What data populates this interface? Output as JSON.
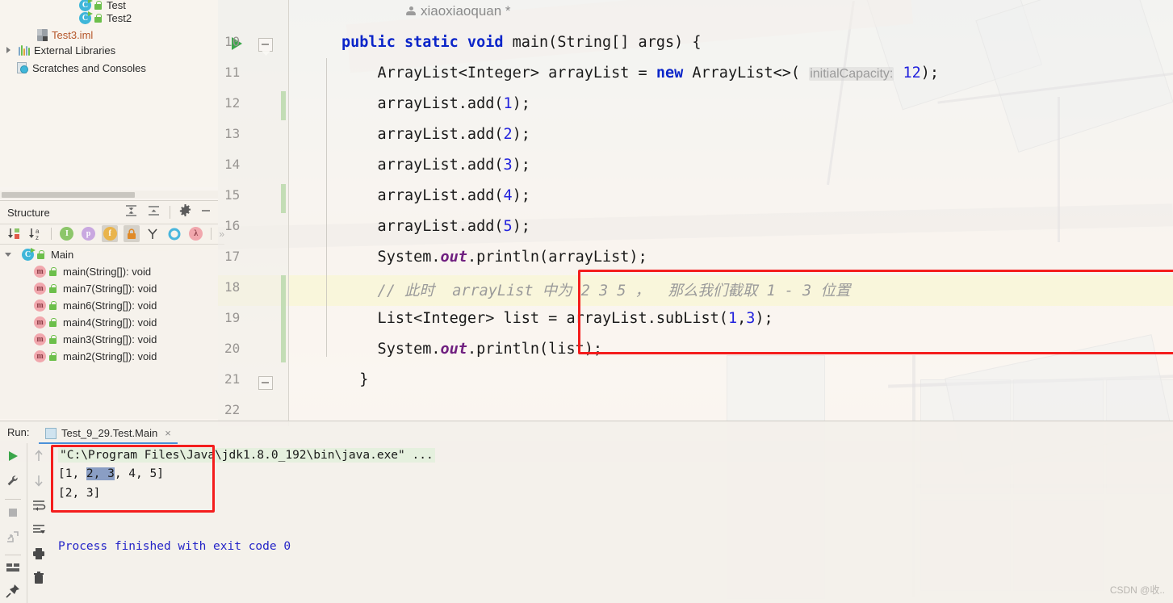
{
  "project": {
    "items": [
      {
        "label": "Test",
        "icon": "java-class-icon"
      },
      {
        "label": "Test2",
        "icon": "java-class-icon"
      },
      {
        "label": "Test3.iml",
        "icon": "iml-file-icon"
      },
      {
        "label": "External Libraries",
        "icon": "library-icon"
      },
      {
        "label": "Scratches and Consoles",
        "icon": "scratches-icon"
      }
    ]
  },
  "structure": {
    "title": "Structure",
    "header_buttons": [
      {
        "name": "expand-all-icon"
      },
      {
        "name": "collapse-all-icon"
      },
      {
        "name": "gear-icon"
      },
      {
        "name": "minimize-icon"
      }
    ],
    "toolbar_buttons": [
      {
        "name": "sort-by-visibility-icon",
        "label": ""
      },
      {
        "name": "sort-alphabetically-icon",
        "label": ""
      },
      {
        "name": "show-inherited-icon",
        "label": "I"
      },
      {
        "name": "show-properties-icon",
        "label": "p"
      },
      {
        "name": "show-fields-icon",
        "label": "f"
      },
      {
        "name": "show-non-public-icon",
        "label": ""
      },
      {
        "name": "group-by-icon",
        "label": ""
      },
      {
        "name": "show-anonymous-icon",
        "label": ""
      },
      {
        "name": "show-lambdas-icon",
        "label": "λ"
      },
      {
        "name": "more-options-icon",
        "label": "»"
      }
    ],
    "root": "Main",
    "members": [
      "main(String[]): void",
      "main7(String[]): void",
      "main6(String[]): void",
      "main4(String[]): void",
      "main3(String[]): void",
      "main2(String[]): void"
    ]
  },
  "editor": {
    "annotation": "xiaoxiaoquan *",
    "first_line_number": 10,
    "line_numbers": [
      10,
      11,
      12,
      13,
      14,
      15,
      16,
      17,
      18,
      19,
      20,
      21,
      22
    ],
    "caret_line": 18,
    "lines": [
      {
        "n": 10,
        "segments": [
          {
            "t": "public static void ",
            "c": "kw"
          },
          {
            "t": "main(String[] args) {",
            "c": ""
          }
        ]
      },
      {
        "n": 11,
        "segments": [
          {
            "t": "    ArrayList<Integer> arrayList = ",
            "c": ""
          },
          {
            "t": "new",
            "c": "kw"
          },
          {
            "t": " ArrayList<>( ",
            "c": ""
          },
          {
            "t": "initialCapacity:",
            "c": "hint"
          },
          {
            "t": " ",
            "c": ""
          },
          {
            "t": "12",
            "c": "num"
          },
          {
            "t": ");",
            "c": ""
          }
        ]
      },
      {
        "n": 12,
        "segments": [
          {
            "t": "    arrayList.add(",
            "c": ""
          },
          {
            "t": "1",
            "c": "num"
          },
          {
            "t": ");",
            "c": ""
          }
        ]
      },
      {
        "n": 13,
        "segments": [
          {
            "t": "    arrayList.add(",
            "c": ""
          },
          {
            "t": "2",
            "c": "num"
          },
          {
            "t": ");",
            "c": ""
          }
        ]
      },
      {
        "n": 14,
        "segments": [
          {
            "t": "    arrayList.add(",
            "c": ""
          },
          {
            "t": "3",
            "c": "num"
          },
          {
            "t": ");",
            "c": ""
          }
        ]
      },
      {
        "n": 15,
        "segments": [
          {
            "t": "    arrayList.add(",
            "c": ""
          },
          {
            "t": "4",
            "c": "num"
          },
          {
            "t": ");",
            "c": ""
          }
        ]
      },
      {
        "n": 16,
        "segments": [
          {
            "t": "    arrayList.add(",
            "c": ""
          },
          {
            "t": "5",
            "c": "num"
          },
          {
            "t": ");",
            "c": ""
          }
        ]
      },
      {
        "n": 17,
        "segments": [
          {
            "t": "    System.",
            "c": ""
          },
          {
            "t": "out",
            "c": "fld"
          },
          {
            "t": ".println(arrayList);",
            "c": ""
          }
        ]
      },
      {
        "n": 18,
        "segments": [
          {
            "t": "    // 此时  arrayList 中为 2 3 5 ，  那么我们截取 1 - 3 位置",
            "c": "cmt"
          }
        ]
      },
      {
        "n": 19,
        "segments": [
          {
            "t": "    List<Integer> list = arrayList.subList(",
            "c": ""
          },
          {
            "t": "1",
            "c": "num"
          },
          {
            "t": ",",
            "c": ""
          },
          {
            "t": "3",
            "c": "num"
          },
          {
            "t": ");",
            "c": ""
          }
        ]
      },
      {
        "n": 20,
        "segments": [
          {
            "t": "    System.",
            "c": ""
          },
          {
            "t": "out",
            "c": "fld"
          },
          {
            "t": ".println(list);",
            "c": ""
          }
        ]
      },
      {
        "n": 21,
        "segments": [
          {
            "t": "  }",
            "c": ""
          }
        ]
      },
      {
        "n": 22,
        "segments": []
      }
    ]
  },
  "run": {
    "label": "Run:",
    "tab_title": "Test_9_29.Test.Main",
    "close_label": "×",
    "toolbar_left": [
      {
        "name": "rerun-icon"
      },
      {
        "name": "edit-configurations-icon"
      },
      {
        "name": "stop-icon"
      },
      {
        "name": "dump-threads-icon"
      },
      {
        "name": "layout-icon"
      },
      {
        "name": "pin-tab-icon"
      }
    ],
    "toolbar_right": [
      {
        "name": "up-arrow-icon"
      },
      {
        "name": "down-arrow-icon"
      },
      {
        "name": "soft-wrap-icon"
      },
      {
        "name": "scroll-to-end-icon"
      },
      {
        "name": "print-icon"
      },
      {
        "name": "clear-all-icon"
      }
    ],
    "console": {
      "command": "\"C:\\Program Files\\Java\\jdk1.8.0_192\\bin\\java.exe\" ...",
      "output_1_pre": "[1, ",
      "output_1_sel": "2, 3",
      "output_1_post": ", 4, 5]",
      "output_2": "[2, 3]",
      "exit": "Process finished with exit code 0"
    }
  },
  "watermark": "CSDN @收..",
  "colors": {
    "highlight_box": "#f41d1d",
    "keyword": "#0b25c9",
    "number": "#2222dd",
    "comment": "#9a9a9a",
    "field": "#702080",
    "vcs_change": "#c3ddb5",
    "caret_line": "#faf5ca",
    "tab_underline": "#4a90d9",
    "console_blue": "#2525c8",
    "selection": "#8a9ec4"
  }
}
